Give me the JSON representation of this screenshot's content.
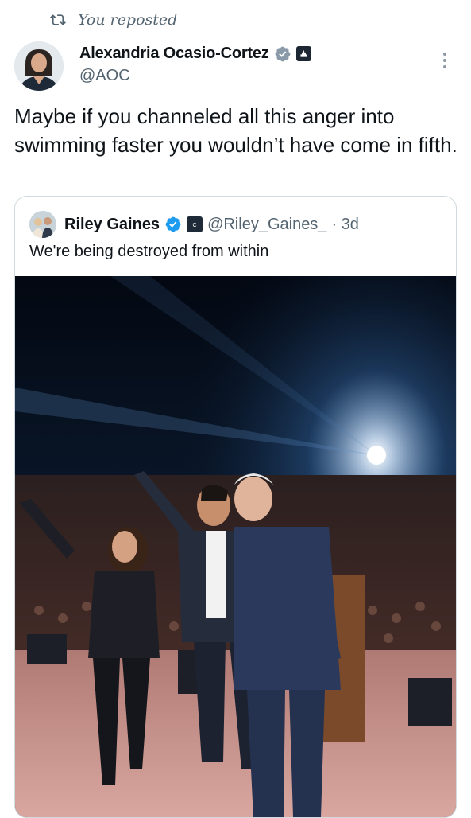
{
  "repost": {
    "label": "You reposted",
    "icon": "repost-icon"
  },
  "author": {
    "name": "Alexandria Ocasio-Cortez",
    "handle": "@AOC",
    "verified_icon": "verified-badge-icon",
    "affiliation_icon": "government-badge-icon"
  },
  "post": {
    "text": "Maybe if you channeled all this anger into swimming faster you wouldn’t have come in fifth."
  },
  "quote": {
    "name": "Riley Gaines",
    "handle": "@Riley_Gaines_",
    "time": "· 3d",
    "text": "We're being destroyed from within",
    "verified_icon": "verified-badge-icon",
    "affiliation_icon": "business-badge-icon"
  },
  "colors": {
    "text": "#0f1419",
    "muted": "#536471",
    "verified": "#8a9aa8",
    "border": "#cfd9de"
  }
}
